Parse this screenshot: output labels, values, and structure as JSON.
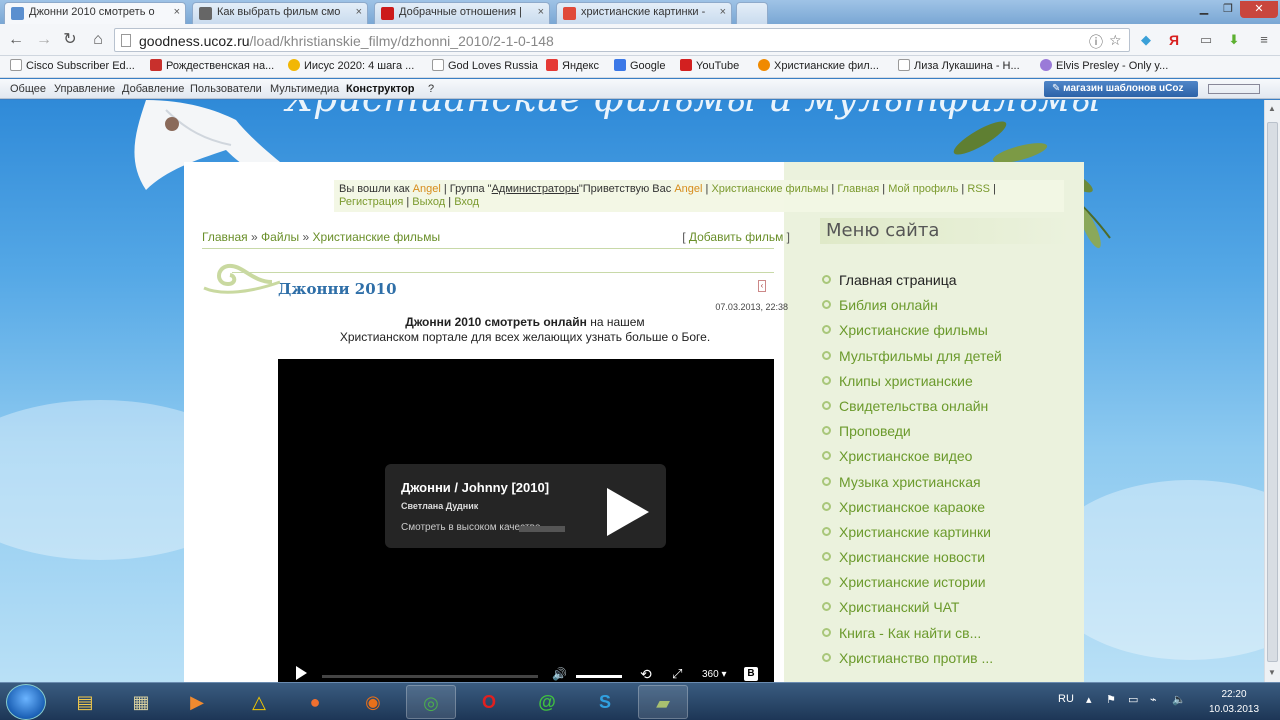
{
  "browser": {
    "tabs": [
      {
        "title": "Джонни 2010 смотреть о",
        "active": true,
        "favicon_color": "#5b8fcf"
      },
      {
        "title": "Как выбрать фильм смо",
        "active": false,
        "favicon_color": "#666666"
      },
      {
        "title": "Добрачные отношения |",
        "active": false,
        "favicon_color": "#cc1b1b"
      },
      {
        "title": "христианские картинки -",
        "active": false,
        "favicon_color": "#e04a3a"
      }
    ],
    "tab_close": "×",
    "url_host": "goodness.ucoz.ru",
    "url_path": "/load/khristianskie_filmy/dzhonni_2010/2-1-0-148",
    "bookmarks": [
      {
        "label": "Cisco Subscriber Ed...",
        "color": "#ffffff"
      },
      {
        "label": "Рождественская на...",
        "color": "#c8302c"
      },
      {
        "label": "Иисус 2020: 4 шага ...",
        "color": "#f2b705"
      },
      {
        "label": "God Loves Russia",
        "color": "#ffffff"
      },
      {
        "label": "Яндекс",
        "color": "#e53935"
      },
      {
        "label": "Google",
        "color": "#3b78e7"
      },
      {
        "label": "YouTube",
        "color": "#d32020"
      },
      {
        "label": "Христианские фил...",
        "color": "#f08a00"
      },
      {
        "label": "Лиза Лукашина - Н...",
        "color": "#ffffff"
      },
      {
        "label": "Elvis Presley - Only y...",
        "color": "#9a7ad8"
      }
    ]
  },
  "ucoz_bar": {
    "items": [
      "Общее",
      "Управление",
      "Добавление",
      "Пользователи",
      "Мультимедиа",
      "Конструктор",
      "?"
    ],
    "shop_button": "магазин шаблонов uCoz"
  },
  "site": {
    "title": "Христианские фильмы и мультфильмы",
    "userbar": {
      "logged_in_as": "Вы вошли как",
      "user": "Angel",
      "group_label": "Группа \"",
      "group": "Администраторы",
      "greeting": "\"Приветствую Вас",
      "links": [
        "Христианские фильмы",
        "Главная",
        "Мой профиль",
        "RSS",
        "Регистрация",
        "Выход",
        "Вход"
      ]
    },
    "breadcrumbs": [
      "Главная",
      "Файлы",
      "Христианские фильмы"
    ],
    "add_film": "Добавить фильм",
    "entry": {
      "title": "Джонни 2010",
      "date": "07.03.2013, 22:38",
      "intro_bold": "Джонни 2010 смотреть онлайн",
      "intro_rest": " на нашем",
      "intro_line2": "Христианском портале для всех желающих узнать больше о Боге."
    },
    "video": {
      "title": "Джонни / Johnny [2010]",
      "author": "Светлана Дудник",
      "hq_label": "Смотреть в высоком качестве",
      "quality": "360"
    },
    "menu": {
      "heading": "Меню сайта",
      "items": [
        "Главная страница",
        "Библия онлайн",
        "Христианские фильмы",
        "Мультфильмы для детей",
        "Клипы христианские",
        "Свидетельства онлайн",
        "Проповеди",
        "Христианское видео",
        "Музыка христианская",
        "Христианское караоке",
        "Христианские картинки",
        "Христианские новости",
        "Христианские истории",
        "Христианский ЧАТ",
        "Книга - Как найти св...",
        "Христианство против ..."
      ]
    }
  },
  "taskbar": {
    "lang": "RU",
    "time": "22:20",
    "date": "10.03.2013"
  }
}
